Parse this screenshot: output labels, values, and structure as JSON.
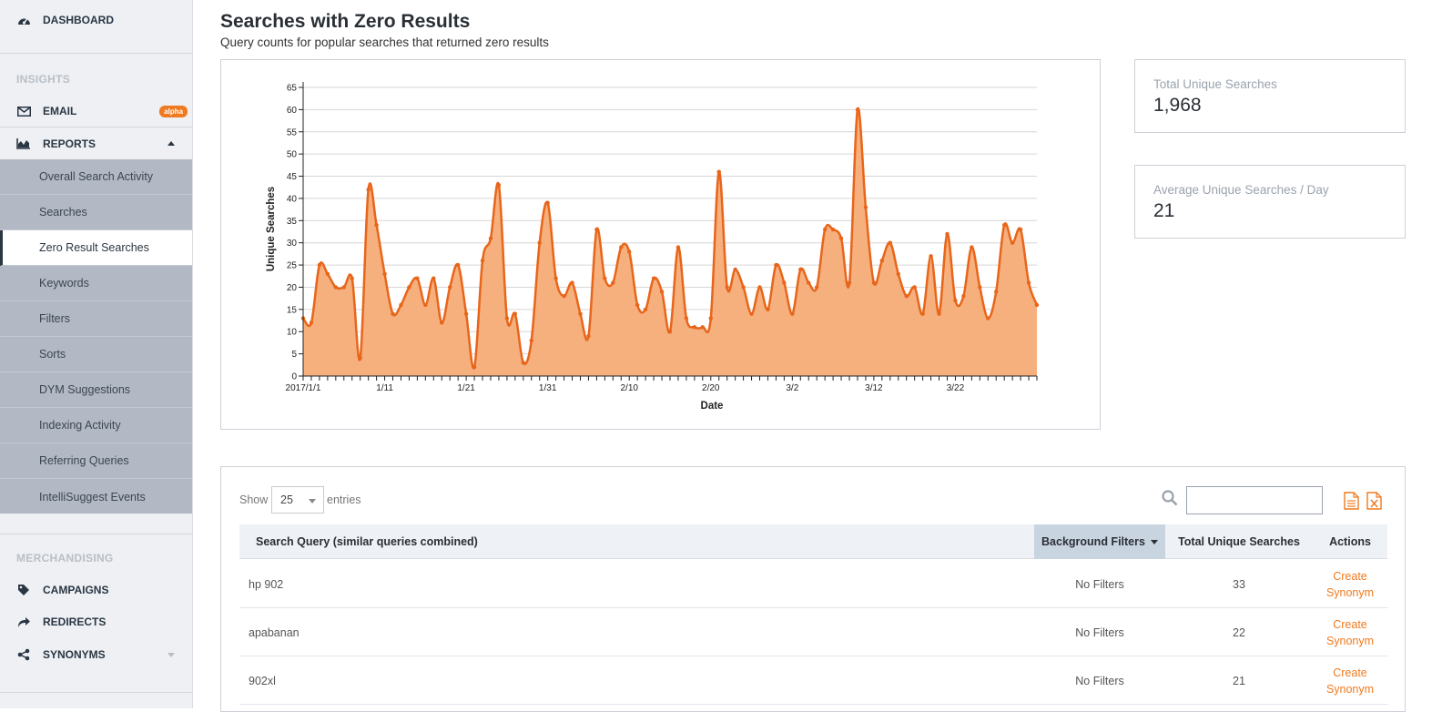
{
  "sidebar": {
    "dashboard": "DASHBOARD",
    "insights_section": "INSIGHTS",
    "email": "EMAIL",
    "email_badge": "alpha",
    "reports": "REPORTS",
    "report_items": [
      "Overall Search Activity",
      "Searches",
      "Zero Result Searches",
      "Keywords",
      "Filters",
      "Sorts",
      "DYM Suggestions",
      "Indexing Activity",
      "Referring Queries",
      "IntelliSuggest Events"
    ],
    "active_report": "Zero Result Searches",
    "merchandising_section": "MERCHANDISING",
    "campaigns": "CAMPAIGNS",
    "redirects": "REDIRECTS",
    "synonyms": "SYNONYMS"
  },
  "page": {
    "title": "Searches with Zero Results",
    "subtitle": "Query counts for popular searches that returned zero results"
  },
  "stats": {
    "total_label": "Total Unique Searches",
    "total_value": "1,968",
    "avg_label": "Average Unique Searches / Day",
    "avg_value": "21"
  },
  "colors": {
    "accent": "#f07a1f",
    "line": "#e8651a",
    "area": "#f5b07e",
    "sidebar_bg": "#eef0f3",
    "submenu_bg": "#b2b9c4"
  },
  "chart_data": {
    "type": "area",
    "xlabel": "Date",
    "ylabel": "Unique Searches",
    "ylim": [
      0,
      65
    ],
    "yticks": [
      0,
      5,
      10,
      15,
      20,
      25,
      30,
      35,
      40,
      45,
      50,
      55,
      60,
      65
    ],
    "xtick_labels": [
      "2017/1/1",
      "1/11",
      "1/21",
      "1/31",
      "2/10",
      "2/20",
      "3/2",
      "3/12",
      "3/22"
    ],
    "grid": true,
    "series": [
      {
        "x_start": "2017/1/1",
        "x_end": "2017/3/31",
        "values": [
          13,
          12,
          25,
          23,
          20,
          20,
          22,
          4,
          42,
          34,
          23,
          14,
          16,
          20,
          22,
          16,
          22,
          12,
          20,
          25,
          14,
          2,
          26,
          31,
          43,
          13,
          14,
          3,
          8,
          30,
          39,
          22,
          18,
          21,
          14,
          9,
          33,
          22,
          21,
          29,
          28,
          16,
          15,
          22,
          19,
          10,
          29,
          13,
          11,
          11,
          13,
          46,
          20,
          24,
          20,
          14,
          20,
          15,
          25,
          21,
          14,
          24,
          21,
          20,
          33,
          33,
          31,
          21,
          60,
          38,
          21,
          26,
          30,
          23,
          18,
          20,
          14,
          27,
          14,
          32,
          17,
          18,
          29,
          20,
          13,
          19,
          34,
          30,
          33,
          21,
          16
        ]
      }
    ]
  },
  "table": {
    "show_label": "Show",
    "page_size": "25",
    "entries_label": "entries",
    "headers": {
      "query": "Search Query (similar queries combined)",
      "filters": "Background Filters",
      "total": "Total Unique Searches",
      "actions": "Actions"
    },
    "rows": [
      {
        "query": "hp 902",
        "filters": "No Filters",
        "total": "33",
        "action_line1": "Create",
        "action_line2": "Synonym"
      },
      {
        "query": "apabanan",
        "filters": "No Filters",
        "total": "22",
        "action_line1": "Create",
        "action_line2": "Synonym"
      },
      {
        "query": "902xl",
        "filters": "No Filters",
        "total": "21",
        "action_line1": "Create",
        "action_line2": "Synonym"
      }
    ]
  }
}
